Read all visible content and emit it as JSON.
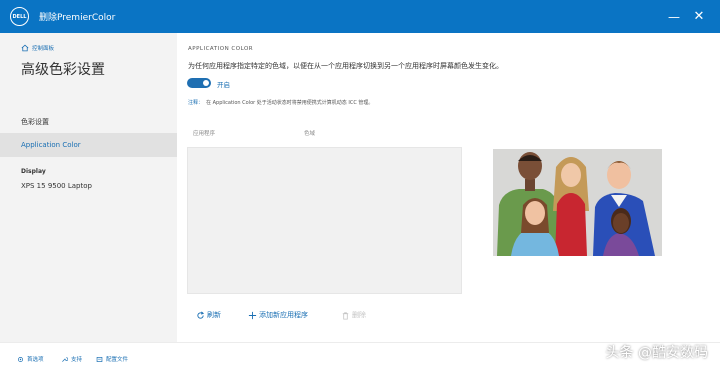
{
  "window": {
    "logo_text": "DELL",
    "title": "删除PremierColor",
    "minimize_glyph": "—",
    "close_glyph": "✕"
  },
  "sidebar": {
    "home_link": "控制面板",
    "title": "高级色彩设置",
    "section_label": "色彩设置",
    "active_item": "Application Color",
    "display_heading": "Display",
    "display_value": "XPS 15 9500 Laptop"
  },
  "main": {
    "heading": "APPLICATION COLOR",
    "description": "为任何应用程序指定特定的色域，以便在从一个应用程序切换到另一个应用程序时屏幕颜色发生变化。",
    "toggle": {
      "label": "开启",
      "on": true
    },
    "note_key": "注释：",
    "note_text": "在 Application Color 处于活动状态时将禁用便携式计算机动态 ICC 管理。",
    "columns": {
      "app": "应用程序",
      "gamut": "色域"
    },
    "actions": {
      "refresh": "刷新",
      "add_app": "添加新应用程序",
      "delete": "删除"
    }
  },
  "footer": {
    "preferences": "首选项",
    "support": "支持",
    "profiles": "配置文件"
  },
  "watermark": "头条 @酷安数码",
  "colors": {
    "titlebar": "#0a74c4",
    "accent": "#1a6fb3",
    "sidebar_bg": "#f3f3f3",
    "sidebar_active": "#e1e1e1"
  }
}
